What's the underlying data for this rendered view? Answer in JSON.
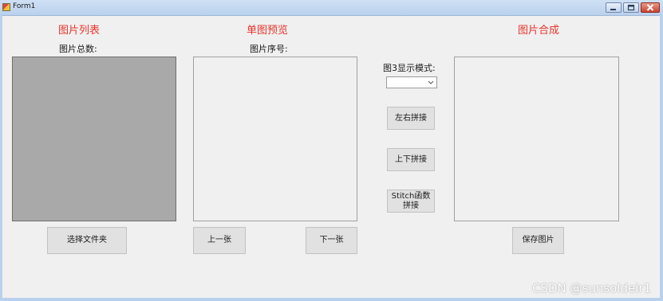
{
  "window": {
    "title": "Form1",
    "controls": [
      "minimize-icon",
      "maximize-icon",
      "close-icon"
    ]
  },
  "sections": {
    "list_header": "图片列表",
    "preview_header": "单图预览",
    "compose_header": "图片合成"
  },
  "labels": {
    "total_count": "图片总数:",
    "sequence_no": "图片序号:",
    "display_mode": "图3显示模式:"
  },
  "combo": {
    "selected": ""
  },
  "buttons": {
    "select_folder": "选择文件夹",
    "prev": "上一张",
    "next": "下一张",
    "left_right": "左右拼接",
    "top_bottom": "上下拼接",
    "stitch": "Stitch函数\n拼接",
    "save": "保存图片"
  },
  "watermark": "CSDN @sunsoldeir1",
  "colors": {
    "header_red": "#e8352c",
    "form_bg": "#f0f0f0",
    "list_box_gray": "#a9a9a9"
  }
}
